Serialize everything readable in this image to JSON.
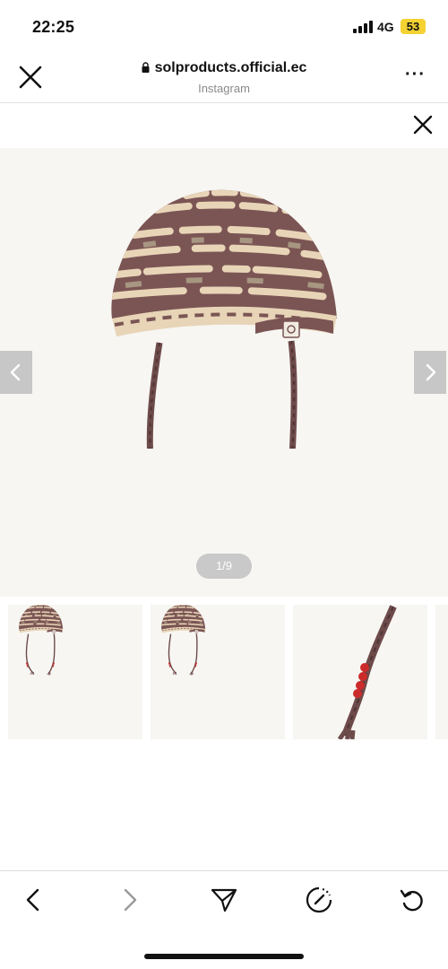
{
  "status_bar": {
    "time": "22:25",
    "network": "4G",
    "battery": "53"
  },
  "browser": {
    "title": "solproducts.official.ec",
    "subtitle": "Instagram"
  },
  "gallery": {
    "page_indicator": "1/9"
  },
  "colors": {
    "battery": "#f5d232",
    "hat_brown": "#7b5554",
    "hat_cream": "#e8d5b8",
    "beads": "#cc2b2b",
    "background": "#f7f6f2"
  },
  "icons": [
    "close-icon",
    "lock-icon",
    "more-icon",
    "chevron-left-icon",
    "chevron-right-icon",
    "back-icon",
    "forward-icon",
    "share-icon",
    "speed-icon",
    "reload-icon"
  ]
}
